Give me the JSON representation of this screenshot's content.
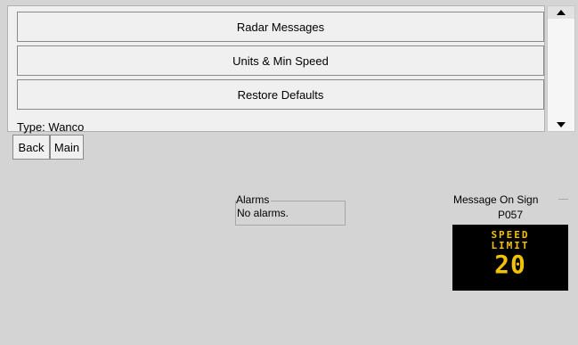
{
  "menu": {
    "items": [
      {
        "label": "Radar Messages"
      },
      {
        "label": "Units & Min Speed"
      },
      {
        "label": "Restore Defaults"
      }
    ],
    "type_label": "Type: Wanco"
  },
  "nav": {
    "back_label": "Back",
    "main_label": "Main"
  },
  "alarms": {
    "title": "Alarms",
    "text": "No alarms."
  },
  "message_on_sign": {
    "title": "Message On Sign",
    "id": "P057",
    "lines": [
      "SPEED",
      "LIMIT",
      "20"
    ],
    "text_color": "#f2c200",
    "background": "#000000"
  },
  "scrollbar": {
    "up_icon": "scroll-up-arrow",
    "down_icon": "scroll-down-arrow"
  }
}
